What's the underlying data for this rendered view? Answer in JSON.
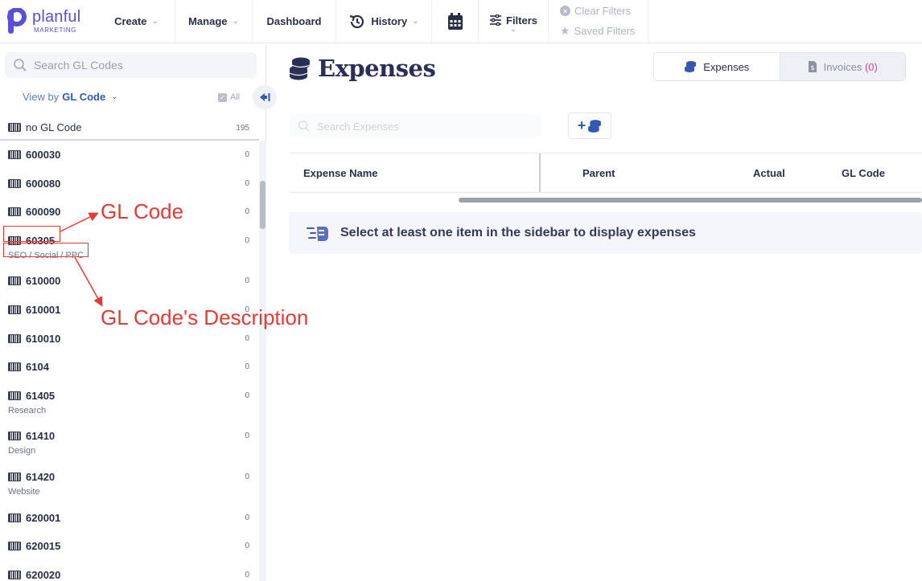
{
  "app": {
    "brand": "planful",
    "brand_sub": "MARKETING"
  },
  "nav": {
    "create": "Create",
    "manage": "Manage",
    "dashboard": "Dashboard",
    "history": "History",
    "filters": "Filters",
    "clear_filters": "Clear Filters",
    "saved_filters": "Saved Filters"
  },
  "sidebar": {
    "search_placeholder": "Search GL Codes",
    "view_by_prefix": "View by",
    "view_by_value": "GL Code",
    "all_label": "All",
    "header_item": {
      "code": "no GL Code",
      "count": "195"
    },
    "items": [
      {
        "code": "600030",
        "count": "0",
        "desc": ""
      },
      {
        "code": "600080",
        "count": "0",
        "desc": ""
      },
      {
        "code": "600090",
        "count": "0",
        "desc": ""
      },
      {
        "code": "60305",
        "count": "0",
        "desc": "SEO / Social / PPC"
      },
      {
        "code": "610000",
        "count": "0",
        "desc": ""
      },
      {
        "code": "610001",
        "count": "0",
        "desc": ""
      },
      {
        "code": "610010",
        "count": "0",
        "desc": ""
      },
      {
        "code": "6104",
        "count": "0",
        "desc": ""
      },
      {
        "code": "61405",
        "count": "0",
        "desc": "Research"
      },
      {
        "code": "61410",
        "count": "0",
        "desc": "Design"
      },
      {
        "code": "61420",
        "count": "0",
        "desc": "Website"
      },
      {
        "code": "620001",
        "count": "0",
        "desc": ""
      },
      {
        "code": "620015",
        "count": "0",
        "desc": ""
      },
      {
        "code": "620020",
        "count": "0",
        "desc": ""
      }
    ]
  },
  "main": {
    "title": "Expenses",
    "tabs": {
      "expenses": "Expenses",
      "invoices": "Invoices",
      "invoices_count": "(0)"
    },
    "search_placeholder": "Search Expenses",
    "add_label": "+",
    "columns": {
      "name": "Expense Name",
      "parent": "Parent",
      "actual": "Actual",
      "gl": "GL Code"
    },
    "empty_message": "Select at least one item in the sidebar to display expenses"
  },
  "annotations": {
    "gl_code": "GL Code",
    "gl_desc": "GL Code's Description"
  },
  "colors": {
    "brand": "#5b4fd6",
    "annotation": "#e53935",
    "link": "#3359b3"
  }
}
